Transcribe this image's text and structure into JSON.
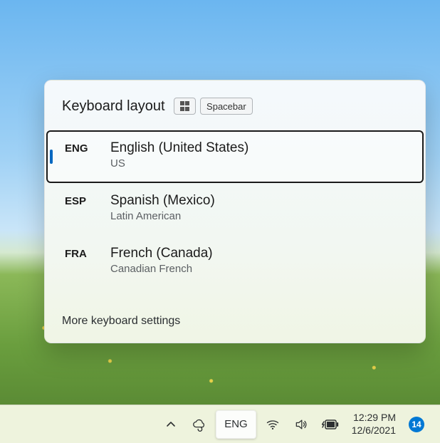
{
  "flyout": {
    "title": "Keyboard layout",
    "shortcut_spacebar": "Spacebar",
    "layouts": [
      {
        "code": "ENG",
        "name": "English (United States)",
        "sub": "US",
        "selected": true
      },
      {
        "code": "ESP",
        "name": "Spanish (Mexico)",
        "sub": "Latin American",
        "selected": false
      },
      {
        "code": "FRA",
        "name": "French (Canada)",
        "sub": "Canadian French",
        "selected": false
      }
    ],
    "more_link": "More keyboard settings"
  },
  "taskbar": {
    "language": "ENG",
    "time": "12:29 PM",
    "date": "12/6/2021",
    "notification_count": "14"
  }
}
